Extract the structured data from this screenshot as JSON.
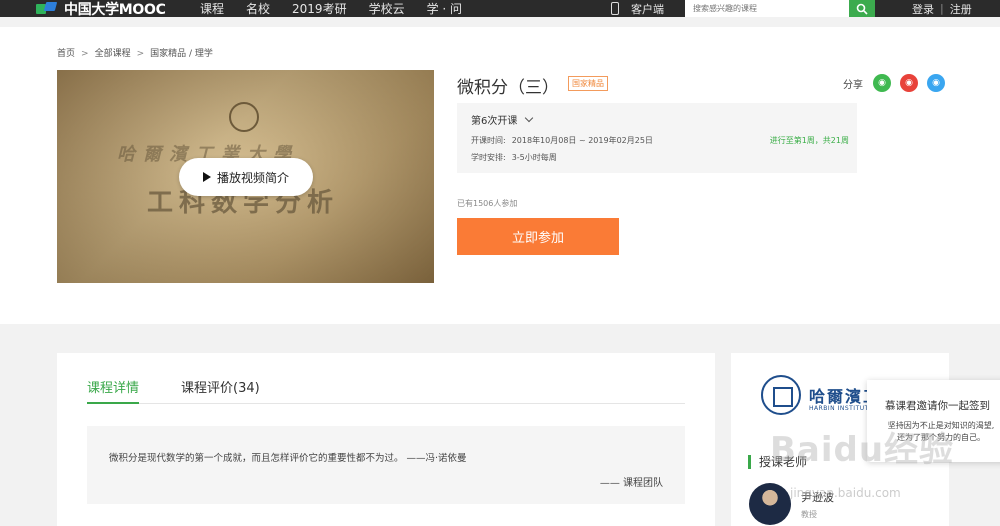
{
  "nav": {
    "logo": "中国大学MOOC",
    "links": [
      "课程",
      "名校",
      "2019考研",
      "学校云",
      "学 · 问"
    ],
    "client_label": "客户端",
    "search_placeholder": "搜索感兴趣的课程",
    "login": "登录",
    "register": "注册",
    "auth_sep": "|"
  },
  "breadcrumb": {
    "items": [
      "首页",
      "全部课程",
      "国家精品 / 理学"
    ],
    "sep": ">"
  },
  "video": {
    "play_label": "播放视频简介",
    "title_text": "工科数学分析",
    "school_script": "哈爾濱工業大學"
  },
  "course": {
    "title": "微积分（三）",
    "badge": "国家精品",
    "share_label": "分享",
    "term": "第6次开课",
    "start_key": "开课时间:",
    "start_value": "2018年10月08日 ~ 2019年02月25日",
    "hours_key": "学时安排:",
    "hours_value": "3-5小时每周",
    "progress": "进行至第1周，共21周",
    "joined": "已有1506人参加",
    "join_button": "立即参加"
  },
  "tabs": [
    {
      "label": "课程详情",
      "active": true
    },
    {
      "label": "课程评价(34)",
      "active": false
    }
  ],
  "quote": {
    "text": "微积分是现代数学的第一个成就，而且怎样评价它的重要性都不为过。 ——冯·诺依曼",
    "source": "—— 课程团队"
  },
  "side": {
    "school_name": "哈爾濱工",
    "school_sub": "HARBIN INSTITUTE",
    "teachers_title": "授课老师",
    "teacher_name": "尹逊波",
    "teacher_title": "教授"
  },
  "popup": {
    "title": "慕课君邀请你一起签到",
    "line1": "坚持因为不止是对知识的渴望,",
    "line2": "还为了那个努力的自己。"
  },
  "watermark": {
    "text": "Baidu经验",
    "sub": "jingyan.baidu.com"
  },
  "colors": {
    "accent_green": "#3aa84a",
    "join_orange": "#fa7b36",
    "nav_bg": "#2b2b2b"
  }
}
